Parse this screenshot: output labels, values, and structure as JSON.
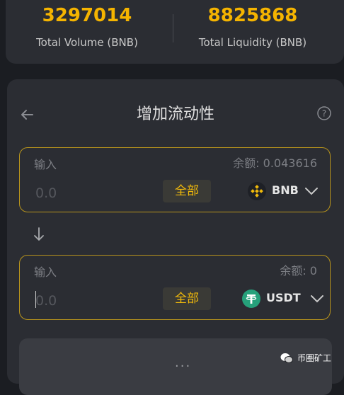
{
  "stats": {
    "total_volume": "3297014",
    "total_volume_label": "Total Volume (BNB)",
    "total_liquidity": "8825868",
    "total_liquidity_label": "Total Liquidity (BNB)"
  },
  "main": {
    "title": "增加流动性",
    "back_icon": "arrow-left-icon",
    "help_icon": "question-circle-icon"
  },
  "input_a": {
    "label": "输入",
    "balance": "余额: 0.043616",
    "placeholder": "0.0",
    "max_label": "全部",
    "token": "BNB"
  },
  "input_b": {
    "label": "输入",
    "balance": "余额: 0",
    "placeholder": "0.0",
    "max_label": "全部",
    "token": "USDT"
  },
  "bottom": {
    "dots": "..."
  },
  "watermark": {
    "text": "币圈矿工"
  },
  "colors": {
    "accent": "#f5b400",
    "border": "#b8941c",
    "card": "#2b2d33",
    "background": "#1b1d22"
  }
}
